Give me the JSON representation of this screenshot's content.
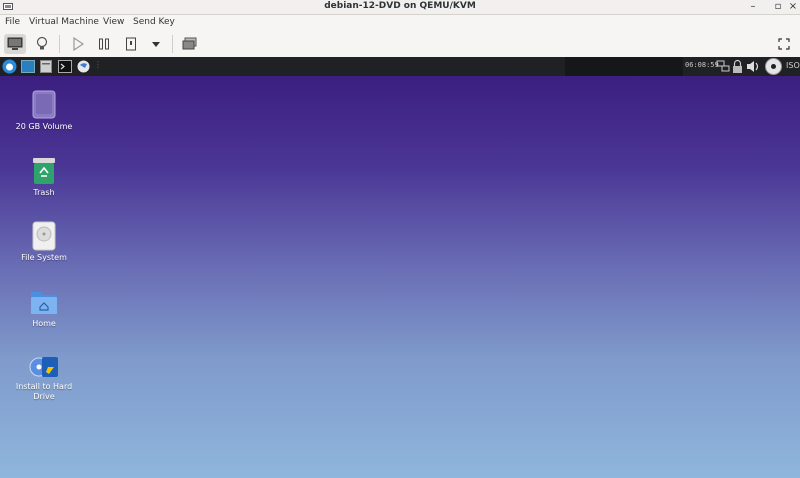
{
  "window": {
    "title": "debian-12-DVD on QEMU/KVM"
  },
  "menu": [
    "File",
    "Virtual Machine",
    "View",
    "Send Key"
  ],
  "panel": {
    "clock": "06:08:59",
    "iso_label": "ISO"
  },
  "desktop_icons": [
    {
      "label": "20 GB Volume",
      "icon": "drive-icon"
    },
    {
      "label": "Trash",
      "icon": "trash-icon"
    },
    {
      "label": "File System",
      "icon": "harddisk-icon"
    },
    {
      "label": "Home",
      "icon": "home-folder-icon"
    },
    {
      "label": "Install to Hard Drive",
      "icon": "installer-icon"
    }
  ],
  "colors": {
    "desktop_top": "#3c1f80",
    "desktop_bottom": "#8fb6dc",
    "panel": "#202124"
  }
}
